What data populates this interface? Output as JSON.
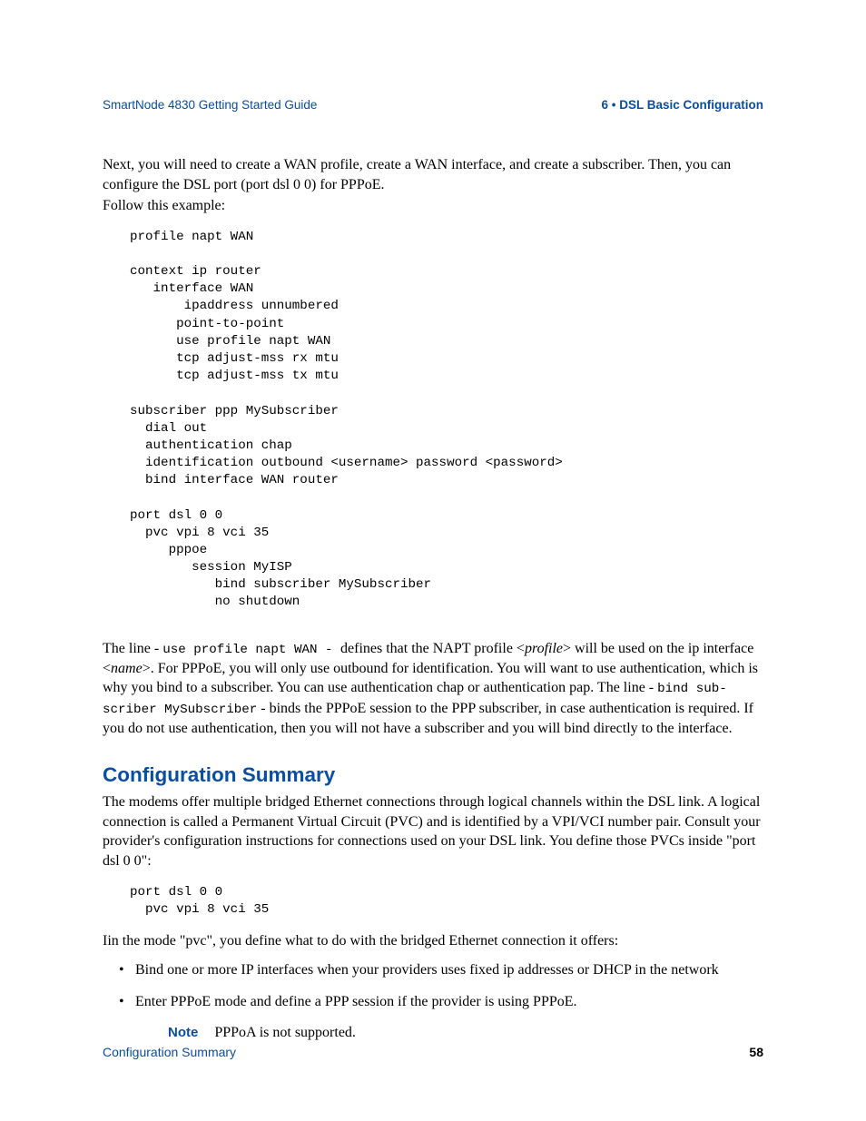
{
  "header": {
    "left": "SmartNode 4830 Getting Started Guide",
    "right": "6 • DSL Basic Configuration"
  },
  "intro": {
    "p1": "Next, you will need to create a WAN profile, create a WAN interface, and create a subscriber. Then, you can configure the DSL port (port dsl 0 0) for PPPoE.",
    "p2": "Follow this example:"
  },
  "code1": "profile napt WAN\n\ncontext ip router\n   interface WAN\n       ipaddress unnumbered\n      point-to-point\n      use profile napt WAN\n      tcp adjust-mss rx mtu\n      tcp adjust-mss tx mtu\n\nsubscriber ppp MySubscriber\n  dial out\n  authentication chap\n  identification outbound <username> password <password>\n  bind interface WAN router\n\nport dsl 0 0\n  pvc vpi 8 vci 35\n     pppoe\n        session MyISP\n           bind subscriber MySubscriber\n           no shutdown",
  "para2": {
    "t1": "The line - ",
    "c1": "use profile napt WAN - ",
    "t2": " defines that the NAPT profile <",
    "i1": "profile",
    "t3": "> will be used on the ip interface <",
    "i2": "name",
    "t4": ">. For PPPoE, you will only use outbound for identification. You will want to use authentication, which is why you bind to a subscriber. You can use authentication chap or authentication pap. The line - ",
    "c2": "bind sub-scriber MySubscriber",
    "t5": " - binds the PPPoE session to the PPP subscriber, in case authentication is required. If you do not use authentication, then you will not have a subscriber and you will bind directly to the interface."
  },
  "section_heading": "Configuration Summary",
  "summary_p1": "The modems offer multiple bridged Ethernet connections through logical channels within the DSL link. A logical connection is called a Permanent Virtual Circuit (PVC) and is identified by a VPI/VCI number pair. Consult your provider's configuration instructions for connections used on your DSL link. You define those PVCs inside \"port dsl 0 0\":",
  "code2": "port dsl 0 0\n  pvc vpi 8 vci 35",
  "summary_p2": "Iin the mode \"pvc\", you define what to do with the bridged Ethernet connection it offers:",
  "bullets": [
    "Bind one or more IP interfaces when your providers uses fixed ip addresses or DHCP in the network",
    "Enter PPPoE mode and define a PPP session if the provider is using PPPoE."
  ],
  "note": {
    "label": "Note",
    "text": "PPPoA is not supported."
  },
  "footer": {
    "left": "Configuration Summary",
    "right": "58"
  }
}
